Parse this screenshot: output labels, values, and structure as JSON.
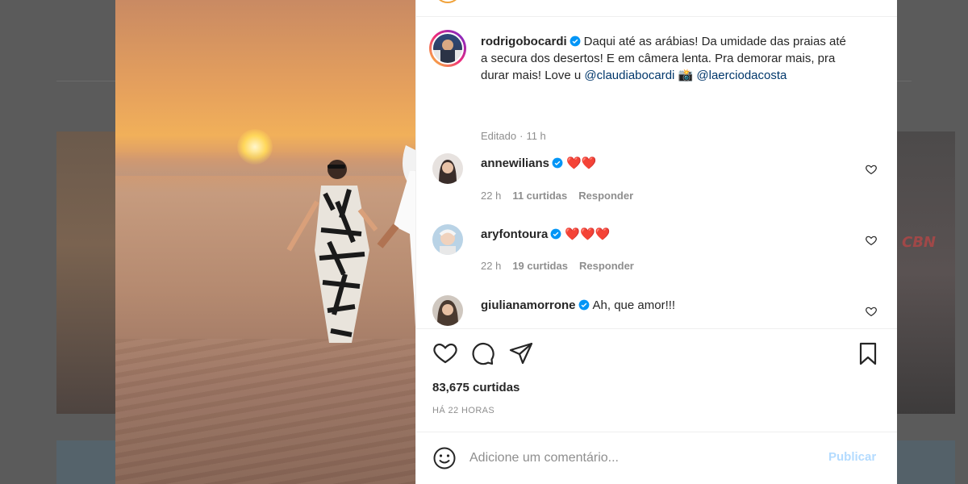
{
  "post": {
    "author": "rodrigobocardi",
    "caption_text": "Daqui até as arábias! Da umidade das praias até a secura dos desertos! E em câmera lenta. Pra demorar mais, pra durar mais! Love u ",
    "mention1": "@claudiabocardi",
    "camera_emoji": "📸",
    "mention2": "@laerciodacosta",
    "edited_label": "Editado",
    "edited_time": "11 h",
    "likes": "83,675 curtidas",
    "time_ago": "HÁ 22 HORAS"
  },
  "comments": [
    {
      "user": "annewilians",
      "text": "❤️❤️",
      "time": "22 h",
      "likes": "11 curtidas",
      "reply": "Responder"
    },
    {
      "user": "aryfontoura",
      "text": "❤️❤️❤️",
      "time": "22 h",
      "likes": "19 curtidas",
      "reply": "Responder"
    },
    {
      "user": "giulianamorrone",
      "text": "Ah, que amor!!!"
    }
  ],
  "composer": {
    "placeholder": "Adicione um comentário...",
    "publish": "Publicar"
  },
  "background": {
    "watermark": "CBN"
  },
  "colors": {
    "verified": "#0095f6",
    "mention": "#00376b",
    "publish_disabled": "#b3dbff",
    "text": "#262626",
    "muted": "#8e8e8e"
  },
  "icons": [
    "mute-icon",
    "verified-icon",
    "heart-icon",
    "comment-icon",
    "share-icon",
    "bookmark-icon",
    "emoji-icon"
  ]
}
